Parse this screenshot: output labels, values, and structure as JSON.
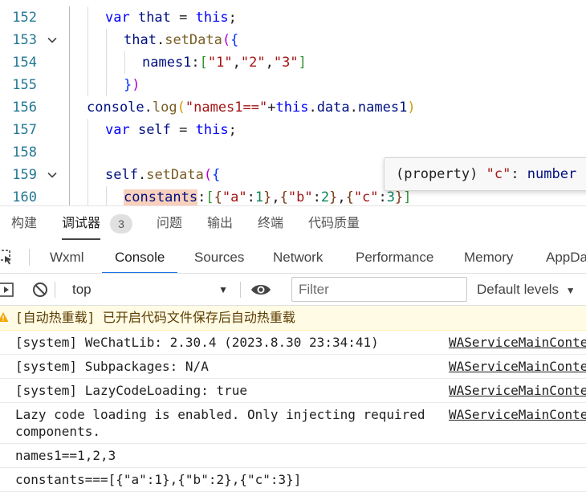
{
  "editor": {
    "lines": [
      {
        "no": "152",
        "tokens": [
          [
            "var",
            "kw"
          ],
          [
            " that ",
            "var"
          ],
          [
            "=",
            ""
          ],
          [
            " ",
            ""
          ],
          [
            "this",
            "kw"
          ],
          [
            ";",
            ""
          ]
        ]
      },
      {
        "no": "153",
        "tokens": [
          [
            "that",
            "var"
          ],
          [
            ".",
            ""
          ],
          [
            "setData",
            "fn"
          ],
          [
            "(",
            "bP"
          ],
          [
            "{",
            "b1"
          ]
        ]
      },
      {
        "no": "154",
        "tokens": [
          [
            "names1",
            "var"
          ],
          [
            ":",
            ""
          ],
          [
            "[",
            "b2"
          ],
          [
            "\"1\"",
            "str"
          ],
          [
            ",",
            ""
          ],
          [
            "\"2\"",
            "str"
          ],
          [
            ",",
            ""
          ],
          [
            "\"3\"",
            "str"
          ],
          [
            "]",
            "b2"
          ]
        ]
      },
      {
        "no": "155",
        "tokens": [
          [
            "}",
            "b1"
          ],
          [
            ")",
            "bP"
          ]
        ]
      },
      {
        "no": "156",
        "tokens": [
          [
            "console",
            "var"
          ],
          [
            ".",
            ""
          ],
          [
            "log",
            "fn"
          ],
          [
            "(",
            "bY"
          ],
          [
            "\"names1==\"",
            "str"
          ],
          [
            "+",
            ""
          ],
          [
            "this",
            "kw"
          ],
          [
            ".",
            ""
          ],
          [
            "data",
            "var"
          ],
          [
            ".",
            ""
          ],
          [
            "names1",
            "var"
          ],
          [
            ")",
            "bY"
          ]
        ]
      },
      {
        "no": "157",
        "tokens": [
          [
            "var",
            "kw"
          ],
          [
            " self ",
            "var"
          ],
          [
            "=",
            ""
          ],
          [
            " ",
            ""
          ],
          [
            "this",
            "kw"
          ],
          [
            ";",
            ""
          ]
        ]
      },
      {
        "no": "158",
        "tokens": []
      },
      {
        "no": "159",
        "tokens": [
          [
            "self",
            "var"
          ],
          [
            ".",
            ""
          ],
          [
            "setData",
            "fn"
          ],
          [
            "(",
            "bP"
          ],
          [
            "{",
            "b1"
          ]
        ]
      },
      {
        "no": "160",
        "tokens": [
          [
            "constants",
            "var hl"
          ],
          [
            ":",
            ""
          ],
          [
            "[",
            "b2"
          ],
          [
            "{",
            "b3"
          ],
          [
            "\"a\"",
            "str"
          ],
          [
            ":",
            ""
          ],
          [
            "1",
            "num"
          ],
          [
            "}",
            "b3"
          ],
          [
            ",",
            ""
          ],
          [
            "{",
            "b3"
          ],
          [
            "\"b\"",
            "str"
          ],
          [
            ":",
            ""
          ],
          [
            "2",
            "num"
          ],
          [
            "}",
            "b3"
          ],
          [
            ",",
            ""
          ],
          [
            "{",
            "b3"
          ],
          [
            "\"c\"",
            "str"
          ],
          [
            ":",
            ""
          ],
          [
            "3",
            "num"
          ],
          [
            "}",
            "b3"
          ],
          [
            "]",
            "b2"
          ]
        ]
      }
    ],
    "tooltip_tokens": [
      [
        "(property) ",
        ""
      ],
      [
        "\"c\"",
        "str"
      ],
      [
        ": ",
        ""
      ],
      [
        "number",
        "var"
      ]
    ]
  },
  "panel_tabs": {
    "build": "构建",
    "debugger": "调试器",
    "debugger_badge": "3",
    "problems": "问题",
    "output": "输出",
    "terminal": "终端",
    "code_quality": "代码质量"
  },
  "devtools_tabs": [
    "Wxml",
    "Console",
    "Sources",
    "Network",
    "Performance",
    "Memory",
    "AppData"
  ],
  "devtools_active": "Console",
  "console_toolbar": {
    "context": "top",
    "filter_placeholder": "Filter",
    "levels": "Default levels"
  },
  "messages": [
    {
      "type": "warn",
      "text": "[自动热重载] 已开启代码文件保存后自动热重载",
      "source": ""
    },
    {
      "type": "log",
      "text": "[system] WeChatLib: 2.30.4 (2023.8.30 23:34:41)",
      "source": "WAServiceMainContext.js"
    },
    {
      "type": "log",
      "text": "[system] Subpackages: N/A",
      "source": "WAServiceMainContext.js"
    },
    {
      "type": "log",
      "text": "[system] LazyCodeLoading: true",
      "source": "WAServiceMainContext.js"
    },
    {
      "type": "log",
      "text": "Lazy code loading is enabled. Only injecting required components.",
      "source": "WAServiceMainContext.js"
    },
    {
      "type": "log",
      "text": "names1==1,2,3",
      "source": ""
    },
    {
      "type": "log",
      "text": "constants===[{\"a\":1},{\"b\":2},{\"c\":3}]",
      "source": ""
    }
  ],
  "colors": {
    "accent": "#1a73e8",
    "line_number": "#237893",
    "keyword": "#0000ff",
    "function": "#795e26",
    "string": "#a31515",
    "warning_bg": "#fffbe5"
  }
}
